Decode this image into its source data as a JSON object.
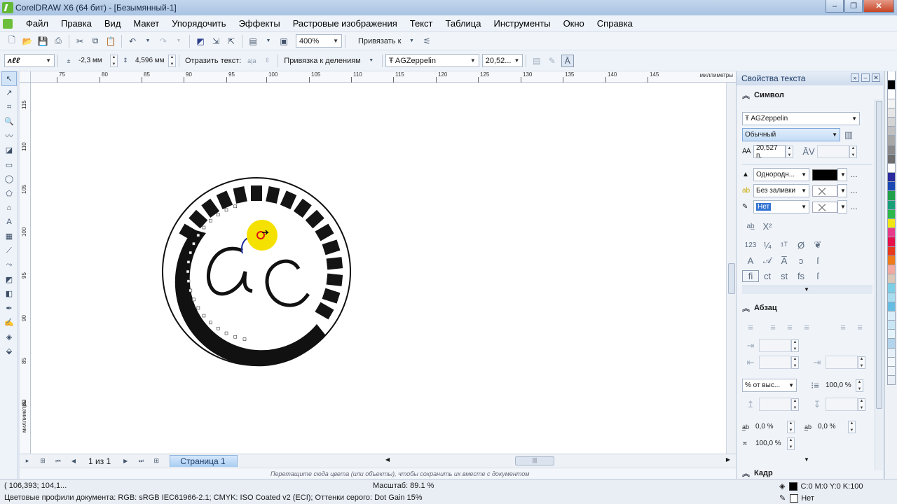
{
  "window": {
    "title": "CorelDRAW X6 (64 бит) - [Безымянный-1]",
    "btn_min": "–",
    "btn_max": "❐",
    "btn_close": "✕"
  },
  "menu": [
    "Файл",
    "Правка",
    "Вид",
    "Макет",
    "Упорядочить",
    "Эффекты",
    "Растровые изображения",
    "Текст",
    "Таблица",
    "Инструменты",
    "Окно",
    "Справка"
  ],
  "toolbar1": {
    "zoom": "400%",
    "snap_label": "Привязать к"
  },
  "toolbar2": {
    "x_offset": "-2,3 мм",
    "y_offset": "4,596 мм",
    "mirror_label": "Отразить текст:",
    "snap_ticks": "Привязка к делениям",
    "font": "AGZeppelin",
    "size": "20,52..."
  },
  "ruler": {
    "h_ticks": [
      "75",
      "80",
      "85",
      "90",
      "95",
      "100",
      "105",
      "110",
      "115",
      "120",
      "125",
      "130",
      "135",
      "140",
      "145"
    ],
    "v_ticks": [
      "115",
      "110",
      "105",
      "100",
      "95",
      "90",
      "85",
      "80"
    ],
    "unit": "миллиметры"
  },
  "pages": {
    "count": "1 из 1",
    "tab": "Страница 1"
  },
  "color_hint": "Перетащите сюда цвета (или объекты), чтобы сохранить их вместе с документом",
  "status": {
    "coords": "( 106,393; 104,1...",
    "zoom": "Масштаб: 89.1 %",
    "profile": "Цветовые профили документа: RGB: sRGB IEC61966-2.1; CMYK: ISO Coated v2 (ECI); Оттенки серого: Dot Gain 15%",
    "fill": "C:0 M:0 Y:0 K:100",
    "outline": "Нет"
  },
  "docker": {
    "title": "Свойства текста",
    "section_symbol": "Символ",
    "font": "AGZeppelin",
    "style": "Обычный",
    "size": "20,527 п.",
    "fill_type": "Однородн...",
    "bg_fill": "Без заливки",
    "outline": "Нет",
    "section_paragraph": "Абзац",
    "line_spacing_unit": "% от выс...",
    "line_spacing": "100,0 %",
    "char_spacing": "0,0 %",
    "word_spacing": "0,0 %",
    "lang_spacing": "100,0 %",
    "section_frame": "Кадр"
  },
  "palette": [
    "#ffffff",
    "#000000",
    "#ffffff",
    "#f4f4f4",
    "#e6e6e6",
    "#d4d4d4",
    "#c0c0c0",
    "#a8a8a8",
    "#8a8a8a",
    "#6e6e6e",
    "#ffffff",
    "#2a2a9e",
    "#1b49b4",
    "#1ea04a",
    "#17a078",
    "#2cb84a",
    "#f2e514",
    "#e83a8a",
    "#e6104a",
    "#e63a1e",
    "#ee7a1a",
    "#f3a9a0",
    "#d9c7b8",
    "#7dcfe6",
    "#a8dcef",
    "#66bde3",
    "#d9eef8",
    "#c9e6f6",
    "#e4f2fa",
    "#b2d4ec",
    "#e6f0f8",
    "#f2f7fb",
    "#eef4fa",
    "#e8eef5"
  ],
  "colors": {
    "accent": "#3374d4",
    "canvas": "#ffffff",
    "fill_black": "#000000",
    "highlight_yellow": "#f5e100"
  }
}
